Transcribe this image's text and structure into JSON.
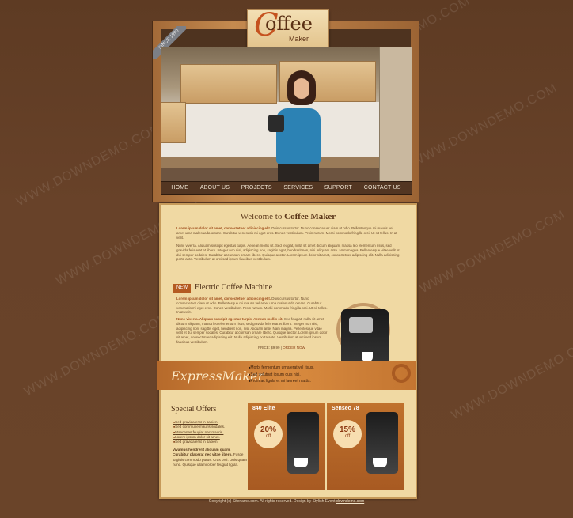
{
  "watermark": "WWW.DOWNDEMO.COM",
  "logo": {
    "title": "offee",
    "c": "C",
    "subtitle": "Maker"
  },
  "ribbon": "SINCE 1990",
  "nav": [
    "HOME",
    "ABOUT US",
    "PROJECTS",
    "SERVICES",
    "SUPPORT",
    "CONTACT US"
  ],
  "welcome": {
    "title_prefix": "Welcome to",
    "title_bold": "Coffee Maker",
    "p1_bold": "Lorem ipsum dolor sit amet, consectetuer adipiscing elit.",
    "p1": "Duis cursus tortor. Nunc consectetuer diam ut odio. Pellentesque mi mauris vel amet urna malesuada ornare. Curabitur venenatis mi eget eros. Donec vestibulum. Proin rutrum. Morbi commodo fringilla orci. Ut sit tellus. In at velit.",
    "p2": "Nunc viverra. Aliquam suscipit egestas turpis. Aenean mollis sit. Sed feugiat, nulla sit amet dictum aliquam, massa leo elementum risus, sed gravida felis erat et libero. Integer non nisi, adipiscing non, sagittis eget, hendrerit non, nisi. Aliquam ante. Nam magna. Pellentesque vitae velit et dui semper sodales. Curabitur accumsan ornare libero. Quisque auctor. Lorem ipsum dolor sit amet, consectetuer adipiscing elit. Nulla adipiscing porta ante. Vestibulum at orci sed ipsum faucibus vestibulum."
  },
  "feature": {
    "badge": "NEW",
    "title": "Electric Coffee Machine",
    "p1_bold": "Lorem ipsum dolor sit amet, consectetuer adipiscing elit.",
    "p1": "Duis cursus tortor. Nunc consectetuer diam ut odio. Pellentesque mi mauris vel amet urna malesuada ornare. Curabitur venenatis mi eget eros. Donec vestibulum. Proin rutrum. Morbi commodo fringilla orci. Ut sit tellus. In at velit.",
    "p2_bold": "Nunc viverra. Aliquam suscipit egestas turpis. Aenean mollis sit.",
    "p2": "Sed feugiat, nulla sit amet dictum aliquam, massa leo elementum risus, sed gravida felis erat et libero. Integer non nisi, adipiscing non, sagittis eget, hendrerit non, nisi. Aliquam ante. Nam magna. Pellentesque vitae velit et dui semper sodales. Curabitur accumsan ornare libero. Quisque auctor. Lorem ipsum dolor sit amet, consectetuer adipiscing elit. Nulla adipiscing porta ante. Vestibulum at orci sed ipsum faucibus vestibulum.",
    "price_label": "PRICE: $9.99",
    "order_link": "ORDER NOW"
  },
  "band": {
    "script": "ExpressMaker",
    "items": [
      "Morbi fermentum urna erat vel risus.",
      "Sed volutpat ipsum quis nisi.",
      "Proin ac ligula et mi laoreet mattis."
    ]
  },
  "special": {
    "title": "Special Offers",
    "links": [
      "Sed gravida erat in sapien.",
      "Sed commune mauris sodales.",
      "Maecenas feugiat nec mauris.",
      "Lorem ipsum dolor sit amet.",
      "Sed gravida erat in sapien."
    ],
    "para_bold": "Vivamus hendrerit aliquam quam. Curabitur placerat nec vitae libero.",
    "para": "Fusce sagittis commodo purus. Cras orci. Duis quam nunc. Quisque ullamcorper feugiat ligula."
  },
  "offers": [
    {
      "name": "840 Elite",
      "pct": "20%",
      "off": "off"
    },
    {
      "name": "Senseo 78",
      "pct": "15%",
      "off": "off"
    }
  ],
  "footer": {
    "text": "Copyright (c) Sitename.com. All rights reserved. Design by Stylish Event ",
    "link": "downdemo.com"
  },
  "colors": {
    "background": "#664028",
    "panel": "#f0d9a3",
    "accent": "#c37531",
    "nav": "#533622"
  }
}
